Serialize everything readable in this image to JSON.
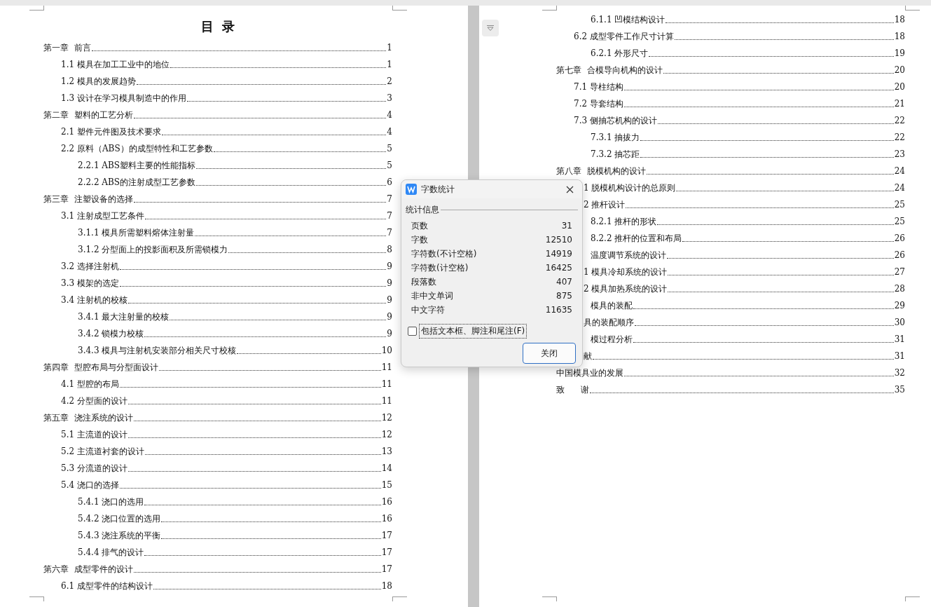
{
  "pages": [
    {
      "title": "目  录",
      "entries": [
        {
          "kind": "chapter",
          "text": "第一章  前言",
          "page": "1"
        },
        {
          "kind": "section",
          "text": "1.1 模具在加工工业中的地位",
          "page": "1"
        },
        {
          "kind": "section",
          "text": "1.2 模具的发展趋势",
          "page": "2"
        },
        {
          "kind": "section",
          "text": "1.3 设计在学习模具制造中的作用",
          "page": "3"
        },
        {
          "kind": "chapter",
          "text": "第二章  塑料的工艺分析",
          "page": "4"
        },
        {
          "kind": "section",
          "text": "2.1 塑件元件图及技术要求",
          "page": "4"
        },
        {
          "kind": "section",
          "text": "2.2 原料（ABS）的成型特性和工艺参数",
          "page": "5"
        },
        {
          "kind": "subsection",
          "text": "2.2.1 ABS塑料主要的性能指标",
          "page": "5"
        },
        {
          "kind": "subsection",
          "text": "2.2.2 ABS的注射成型工艺参数",
          "page": "6"
        },
        {
          "kind": "chapter",
          "text": "第三章  注塑设备的选择",
          "page": "7"
        },
        {
          "kind": "section",
          "text": "3.1 注射成型工艺条件",
          "page": "7"
        },
        {
          "kind": "subsection",
          "text": "3.1.1 模具所需塑料熔体注射量",
          "page": "7"
        },
        {
          "kind": "subsection",
          "text": "3.1.2 分型面上的投影面积及所需锁模力",
          "page": "8"
        },
        {
          "kind": "section",
          "text": "3.2 选择注射机",
          "page": "9"
        },
        {
          "kind": "section",
          "text": "3.3 模架的选定",
          "page": "9"
        },
        {
          "kind": "section",
          "text": "3.4 注射机的校核",
          "page": "9"
        },
        {
          "kind": "subsection",
          "text": "3.4.1 最大注射量的校核",
          "page": "9"
        },
        {
          "kind": "subsection",
          "text": "3.4.2 锁模力校核",
          "page": "9"
        },
        {
          "kind": "subsection",
          "text": "3.4.3 模具与注射机安装部分相关尺寸校核",
          "page": "10"
        },
        {
          "kind": "chapter",
          "text": "第四章  型腔布局与分型面设计",
          "page": "11"
        },
        {
          "kind": "section",
          "text": "4.1 型腔的布局",
          "page": "11"
        },
        {
          "kind": "section",
          "text": "4.2 分型面的设计",
          "page": "11"
        },
        {
          "kind": "chapter",
          "text": "第五章  浇注系统的设计",
          "page": "12"
        },
        {
          "kind": "section",
          "text": "5.1 主流道的设计",
          "page": "12"
        },
        {
          "kind": "section",
          "text": "5.2 主流道衬套的设计",
          "page": "13"
        },
        {
          "kind": "section",
          "text": "5.3 分流道的设计",
          "page": "14"
        },
        {
          "kind": "section",
          "text": "5.4 浇口的选择",
          "page": "15"
        },
        {
          "kind": "subsection",
          "text": "5.4.1 浇口的选用",
          "page": "16"
        },
        {
          "kind": "subsection",
          "text": "5.4.2 浇口位置的选用",
          "page": "16"
        },
        {
          "kind": "subsection",
          "text": "5.4.3 浇注系统的平衡",
          "page": "17"
        },
        {
          "kind": "subsection",
          "text": "5.4.4 排气的设计",
          "page": "17"
        },
        {
          "kind": "chapter",
          "text": "第六章  成型零件的设计",
          "page": "17"
        },
        {
          "kind": "section",
          "text": "6.1 成型零件的结构设计",
          "page": "18"
        }
      ]
    },
    {
      "entries": [
        {
          "kind": "subsection",
          "text": "6.1.1 凹模结构设计",
          "page": "18"
        },
        {
          "kind": "section",
          "text": "6.2 成型零件工作尺寸计算",
          "page": "18"
        },
        {
          "kind": "subsection",
          "text": "6.2.1 外形尺寸",
          "page": "19"
        },
        {
          "kind": "chapter",
          "text": "第七章  合模导向机构的设计",
          "page": "20"
        },
        {
          "kind": "section",
          "text": "7.1 导柱结构",
          "page": "20"
        },
        {
          "kind": "section",
          "text": "7.2 导套结构",
          "page": "21"
        },
        {
          "kind": "section",
          "text": "7.3 侧抽芯机构的设计",
          "page": "22"
        },
        {
          "kind": "subsection",
          "text": "7.3.1 抽拔力",
          "page": "22"
        },
        {
          "kind": "subsection",
          "text": "7.3.2 抽芯距",
          "page": "23"
        },
        {
          "kind": "chapter",
          "text": "第八章  脱模机构的设计",
          "page": "24"
        },
        {
          "kind": "partial",
          "text": "1 脱模机构设计的总原则",
          "page": "24"
        },
        {
          "kind": "partial",
          "text": "2 推杆设计",
          "page": "25"
        },
        {
          "kind": "subsection",
          "text": "8.2.1 推杆的形状",
          "page": "25"
        },
        {
          "kind": "subsection",
          "text": "8.2.2 推杆的位置和布局",
          "page": "26"
        },
        {
          "kind": "bare",
          "text": "温度调节系统的设计",
          "page": "26"
        },
        {
          "kind": "partial",
          "text": "1 模具冷却系统的设计",
          "page": "27"
        },
        {
          "kind": "partial",
          "text": "2 模具加热系统的设计",
          "page": "28"
        },
        {
          "kind": "bare",
          "text": "模具的装配",
          "page": "29"
        },
        {
          "kind": "partial",
          "text": "具的装配顺序",
          "page": "30"
        },
        {
          "kind": "bare",
          "text": "模过程分析",
          "page": "31"
        },
        {
          "kind": "partial",
          "text": "献",
          "page": "31"
        },
        {
          "kind": "chapter",
          "text": "中国模具业的发展",
          "page": "32"
        },
        {
          "kind": "chapter",
          "text": "致      谢",
          "page": "35"
        }
      ]
    }
  ],
  "dialog": {
    "title": "字数统计",
    "group": "统计信息",
    "stats": [
      {
        "label": "页数",
        "value": "31"
      },
      {
        "label": "字数",
        "value": "12510"
      },
      {
        "label": "字符数(不计空格)",
        "value": "14919"
      },
      {
        "label": "字符数(计空格)",
        "value": "16425"
      },
      {
        "label": "段落数",
        "value": "407"
      },
      {
        "label": "非中文单词",
        "value": "875"
      },
      {
        "label": "中文字符",
        "value": "11635"
      }
    ],
    "checkbox": {
      "label": "包括文本框、脚注和尾注(F)",
      "checked": false
    },
    "button": "关闭"
  }
}
